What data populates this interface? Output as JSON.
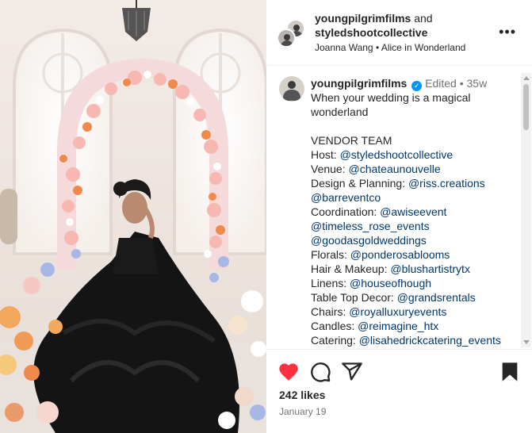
{
  "colors": {
    "like_red": "#ff3040",
    "tag_blue": "#00376b",
    "verified_blue": "#0095f6",
    "muted": "#737373",
    "gown": "#141414"
  },
  "header": {
    "user1": "youngpilgrimfilms",
    "and": "and",
    "user2": "styledshootcollective",
    "subtitle": "Joanna Wang • Alice in Wonderland",
    "more_icon": "more-options-icon",
    "more_glyph": "•••"
  },
  "caption": {
    "username": "youngpilgrimfilms",
    "verified_icon": "verified-badge-icon",
    "verified_glyph": "✓",
    "edited": "Edited",
    "dot": "•",
    "age": "35w",
    "line1": "When your wedding is a magical",
    "line2": "wonderland",
    "vendor_heading": "VENDOR TEAM",
    "vendors": [
      {
        "label": "Host: ",
        "tag": "@styledshootcollective"
      },
      {
        "label": "Venue: ",
        "tag": "@chateaunouvelle"
      },
      {
        "label": "Design & Planning: ",
        "tag": "@riss.creations"
      },
      {
        "label": "",
        "tag": "@barreventco"
      },
      {
        "label": "Coordination: ",
        "tag": "@awiseevent"
      },
      {
        "label": "",
        "tag": "@timeless_rose_events"
      },
      {
        "label": "",
        "tag": "@goodasgoldweddings"
      },
      {
        "label": "Florals: ",
        "tag": "@ponderosablooms"
      },
      {
        "label": "Hair & Makeup: ",
        "tag": "@blushartistrytx"
      },
      {
        "label": "Linens: ",
        "tag": "@houseofhough"
      },
      {
        "label": "Table Top Decor: ",
        "tag": "@grandsrentals"
      },
      {
        "label": "Chairs: ",
        "tag": "@royalluxuryevents"
      },
      {
        "label": "Candles: ",
        "tag": "@reimagine_htx"
      },
      {
        "label": "Catering: ",
        "tag": "@lisahedrickcatering_events"
      }
    ]
  },
  "actions": {
    "like_icon": "heart-filled-icon",
    "comment_icon": "comment-icon",
    "share_icon": "share-icon",
    "save_icon": "bookmark-icon",
    "likes": "242 likes",
    "date": "January 19"
  }
}
